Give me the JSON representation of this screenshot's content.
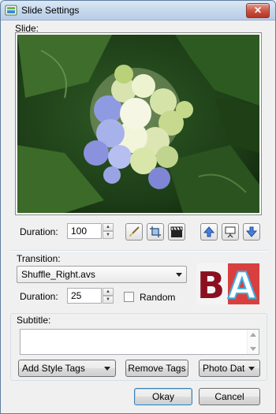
{
  "window": {
    "title": "Slide Settings",
    "close_label": "✕"
  },
  "slide": {
    "section_label": "Slide:",
    "duration_label": "Duration:",
    "duration_value": "100"
  },
  "transition": {
    "section_label": "Transition:",
    "selected_file": "Shuffle_Right.avs",
    "duration_label": "Duration:",
    "duration_value": "25",
    "random_label": "Random",
    "random_checked": false,
    "preview_text_a": "B",
    "preview_text_b": "A"
  },
  "subtitle": {
    "section_label": "Subtitle:",
    "value": ""
  },
  "buttons": {
    "add_style_tags": "Add Style Tags",
    "remove_tags": "Remove Tags",
    "photo_date": "Photo Dat",
    "okay": "Okay",
    "cancel": "Cancel"
  },
  "icons": {
    "tools": [
      "brush-icon",
      "crop-icon",
      "clapperboard-icon"
    ],
    "nav": [
      "move-up-icon",
      "presentation-icon",
      "move-down-icon"
    ]
  },
  "colors": {
    "title_bar": "#c4d7ec",
    "close_button": "#c8503f"
  }
}
